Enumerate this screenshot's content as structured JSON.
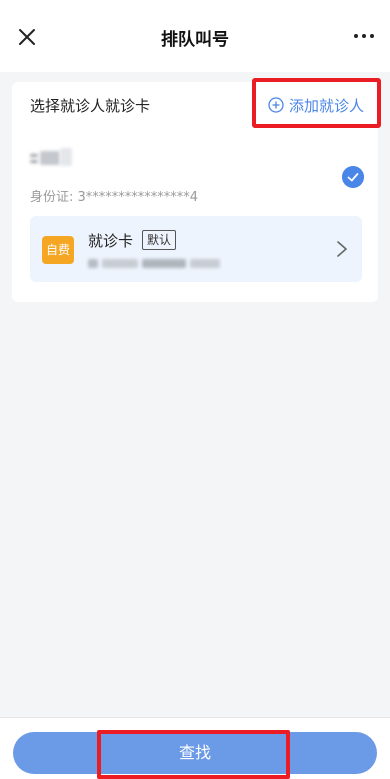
{
  "header": {
    "title": "排队叫号",
    "close_icon": "close-icon",
    "more_icon": "more-dots-icon"
  },
  "card": {
    "title": "选择就诊人就诊卡",
    "add_label": "添加就诊人",
    "id_line": "身份证: 3****************4",
    "tag_label": "自费",
    "card_label": "就诊卡",
    "default_label": "默认"
  },
  "footer": {
    "search_label": "查找"
  },
  "colors": {
    "accent": "#4a86e8",
    "button": "#6b9be6",
    "tag": "#f5a623",
    "highlight": "#ec1c24"
  }
}
